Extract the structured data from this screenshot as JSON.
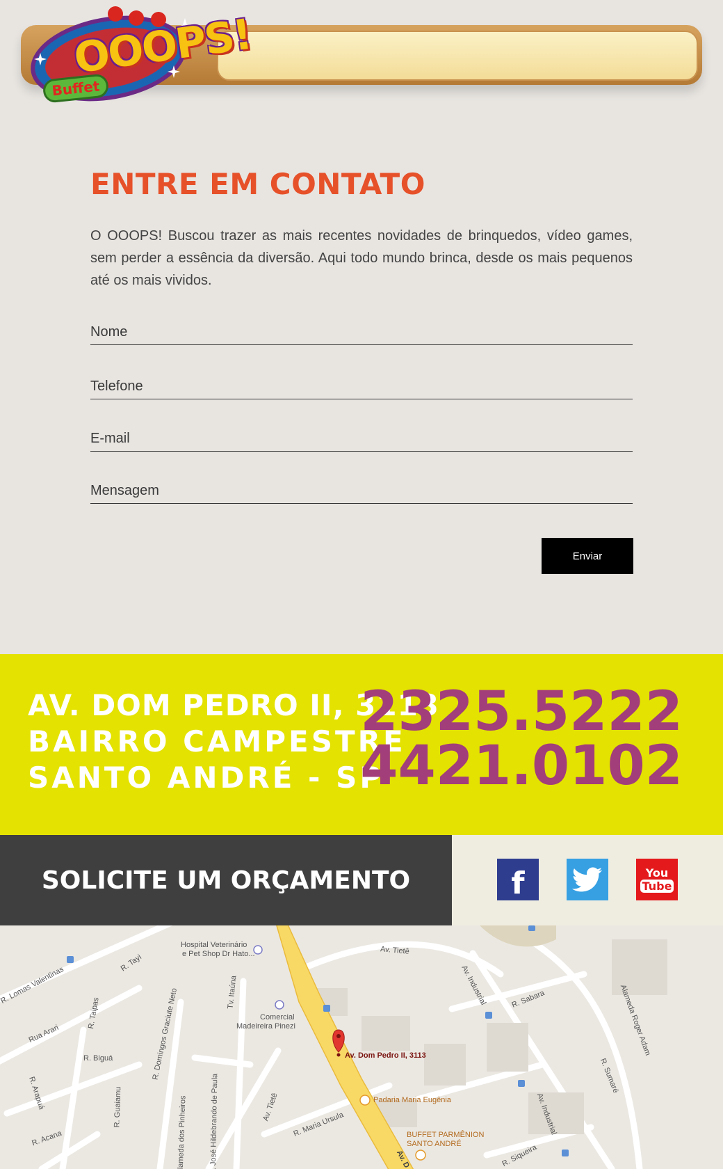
{
  "header": {
    "logo_text": "OOOPS!",
    "logo_sub": "Buffet"
  },
  "contact": {
    "title": "ENTRE EM CONTATO",
    "text": "O OOOPS! Buscou trazer as mais recentes novidades de brinquedos, vídeo games, sem perder a essência da diversão. Aqui todo mundo brinca, desde os mais pequenos até os mais vividos.",
    "fields": {
      "name_placeholder": "Nome",
      "phone_placeholder": "Telefone",
      "email_placeholder": "E-mail",
      "message_placeholder": "Mensagem"
    },
    "submit_label": "Enviar"
  },
  "info": {
    "address_line1": "AV. DOM PEDRO II, 3113",
    "address_line2": "BAIRRO CAMPESTRE",
    "address_line3": "SANTO ANDRÉ - SP",
    "phone1": "2325.5222",
    "phone2": "4421.0102"
  },
  "cta": {
    "label": "SOLICITE UM ORÇAMENTO"
  },
  "social": {
    "facebook_glyph": "f",
    "youtube_line1": "You",
    "youtube_line2": "Tube"
  },
  "map": {
    "marker_label": "Av. Dom Pedro II, 3113",
    "labels": {
      "hospital1": "Hospital Veterinário",
      "hospital2": "e Pet Shop Dr Hato...",
      "tiete_top": "Av. Tietê",
      "lomas": "R. Lomas Valentinas",
      "tayi": "R. Tayi",
      "taipas": "R. Taipas",
      "graciute": "R. Domingos Graciute Neto",
      "itauna": "Tv. Itaúna",
      "comercial1": "Comercial",
      "comercial2": "Madeireira Pinezi",
      "arari": "Rua Arari",
      "bigua": "R. Biguá",
      "arapua": "R. Arapuá",
      "guaiamu": "R. Guaiamu",
      "pinheiros": "Alameda dos Pinheiros",
      "hildebrando": "R. José Hildebrando de Paula",
      "tiete_bottom": "Av. Tietê",
      "maria_ursula": "R. Maria Ursula",
      "acana": "R. Acana",
      "padaria": "Padaria Maria Eugênia",
      "parmenion1": "BUFFET PARMÊNION",
      "parmenion2": "SANTO ANDRÉ",
      "industrial_top": "Av. Industrial",
      "sabara": "R. Sabara",
      "industrial_bottom": "Av. Industrial",
      "roger_adam": "Alameda Roger Adam",
      "sumare": "R. Sumaré",
      "siqueira": "R. Siqueira",
      "av_dom_bottom": "Av. D"
    }
  },
  "colors": {
    "title": "#e6512a",
    "band": "#e4e200",
    "phone": "#a23e7a",
    "cta_bg": "#3f3f3f",
    "facebook": "#2f3d8f",
    "twitter": "#36a0e3",
    "youtube": "#e4191c"
  }
}
